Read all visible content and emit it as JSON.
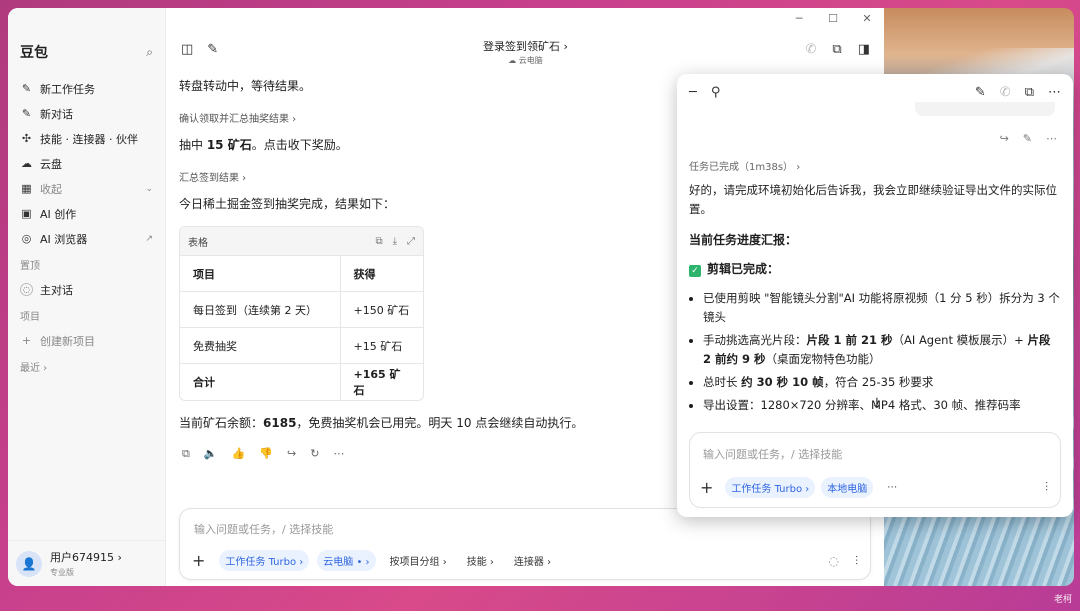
{
  "desktop": {
    "watermark": "老柯"
  },
  "window_controls": {
    "minimize": "─",
    "maximize": "☐",
    "close": "✕"
  },
  "sidebar": {
    "title": "豆包",
    "items": [
      {
        "label": "新工作任务",
        "icon": "✎"
      },
      {
        "label": "新对话",
        "icon": "✎"
      },
      {
        "label": "技能 · 连接器 · 伙伴",
        "icon": "✣"
      },
      {
        "label": "云盘",
        "icon": "☁"
      },
      {
        "label": "收起",
        "icon": "▦"
      },
      {
        "label": "AI 创作",
        "icon": "▣"
      },
      {
        "label": "AI 浏览器",
        "icon": "◎"
      }
    ],
    "pinned_section": "置顶",
    "pinned_item": "主对话",
    "projects_section": "项目",
    "new_project": "创建新项目",
    "recent_section": "最近 ›",
    "user": {
      "name": "用户674915 ›",
      "plan": "专业版"
    }
  },
  "header": {
    "title": "登录签到领矿石 ›",
    "subtitle": "☁ 云电脑"
  },
  "chat": {
    "line1": "转盘转动中，等待结果。",
    "link1": "确认领取并汇总抽奖结果 ›",
    "line2_pre": "抽中 ",
    "line2_bold": "15 矿石",
    "line2_post": "。点击收下奖励。",
    "link2": "汇总签到结果 ›",
    "line3": "今日稀土掘金签到抽奖完成，结果如下：",
    "table": {
      "label": "表格",
      "headers": [
        "项目",
        "获得"
      ],
      "rows": [
        [
          "每日签到（连续第 2 天）",
          "+150 矿石"
        ],
        [
          "免费抽奖",
          "+15 矿石"
        ]
      ],
      "total": [
        "合计",
        "+165 矿石"
      ]
    },
    "summary_pre": "当前矿石余额：",
    "summary_bold": "6185",
    "summary_post": "，免费抽奖机会已用完。明天 10 点会继续自动执行。"
  },
  "input": {
    "placeholder": "输入问题或任务，/ 选择技能",
    "add": "+",
    "chips": [
      "工作任务 Turbo ›",
      "云电脑 • ›",
      "按项目分组 ›",
      "技能 ›",
      "连接器 ›"
    ]
  },
  "panel": {
    "task_done": "任务已完成（1m38s） ›",
    "intro": "好的，请完成环境初始化后告诉我，我会立即继续验证导出文件的实际位置。",
    "report_title": "当前任务进度汇报：",
    "edit_done": "剪辑已完成：",
    "bullets": [
      {
        "pre": "已使用剪映 \"智能镜头分割\"AI 功能将原视频（1 分 5 秒）拆分为 3 个镜头",
        "b1": "",
        "mid": "",
        "b2": "",
        "post": ""
      },
      {
        "pre": "手动挑选高光片段：",
        "b1": "片段 1 前 21 秒",
        "mid": "（AI Agent 模板展示）+ ",
        "b2": "片段 2 前约 9 秒",
        "post": "（桌面宠物特色功能）"
      },
      {
        "pre": "总时长 ",
        "b1": "约 30 秒 10 帧",
        "mid": "，符合 25-35 秒要求",
        "b2": "",
        "post": ""
      },
      {
        "pre": "导出设置：1280×720 分辨率、MP4 格式、30 帧、推荐码率",
        "b1": "",
        "mid": "",
        "b2": "",
        "post": ""
      }
    ],
    "placeholder": "输入问题或任务，/ 选择技能",
    "chips": [
      "工作任务 Turbo ›",
      "本地电脑"
    ]
  }
}
